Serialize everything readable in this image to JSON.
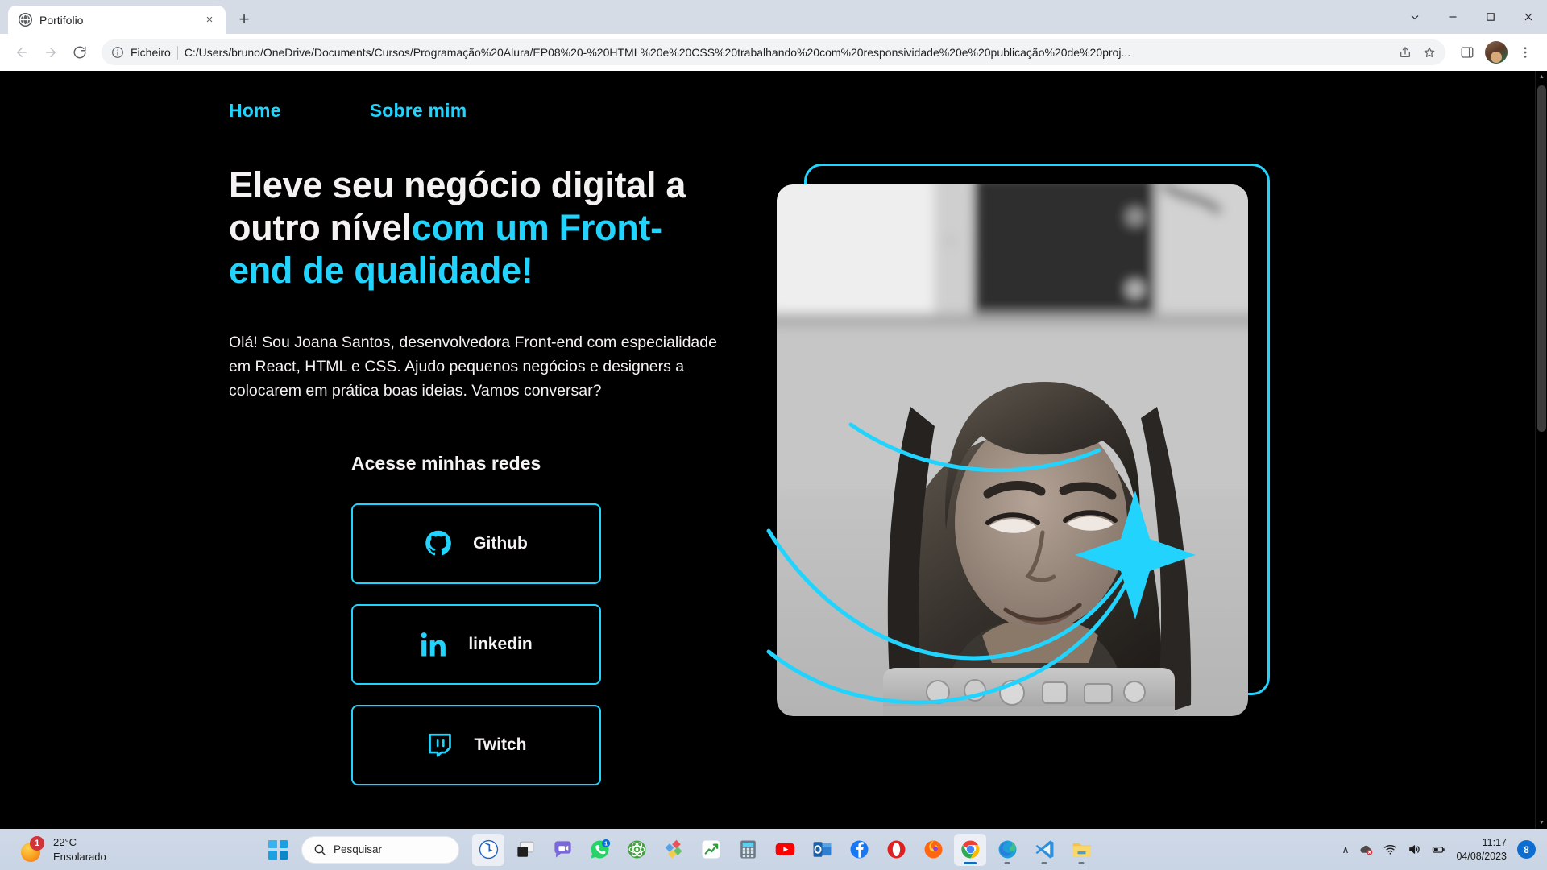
{
  "browser": {
    "tab": {
      "title": "Portifolio",
      "favicon": "globe-icon",
      "close_label": "×"
    },
    "new_tab_label": "+",
    "window_controls": {
      "minimize": "─",
      "maximize": "□",
      "close": "✕",
      "more": "⌄"
    },
    "toolbar": {
      "back": "back-arrow",
      "forward": "forward-arrow",
      "reload": "reload-icon",
      "scheme_label": "Ficheiro",
      "url": "C:/Users/bruno/OneDrive/Documents/Cursos/Programação%20Alura/EP08%20-%20HTML%20e%20CSS%20trabalhando%20com%20responsividade%20e%20publicação%20de%20proj...",
      "share": "share-icon",
      "bookmark": "star-icon",
      "sidepanel": "side-panel-icon",
      "menu": "kebab-menu-icon"
    }
  },
  "page": {
    "nav": [
      {
        "label": "Home"
      },
      {
        "label": "Sobre mim"
      }
    ],
    "headline": {
      "line_white": "Eleve seu negócio digital a outro nível",
      "line_accent": "com um Front-end de qualidade!"
    },
    "paragraph": "Olá! Sou Joana Santos, desenvolvedora Front-end com especialidade em React, HTML e CSS. Ajudo pequenos negócios e designers a colocarem em prática boas ideias. Vamos conversar?",
    "links_title": "Acesse minhas redes",
    "links": [
      {
        "label": "Github",
        "icon": "github-icon"
      },
      {
        "label": "linkedin",
        "icon": "linkedin-icon"
      },
      {
        "label": "Twitch",
        "icon": "twitch-icon"
      }
    ],
    "colors": {
      "accent": "#22d4fd",
      "background": "#000000",
      "text": "#f5f2f2"
    },
    "photo_alt": "portrait-photo-grayscale"
  },
  "taskbar": {
    "weather": {
      "temperature": "22°C",
      "condition": "Ensolarado",
      "badge": "1"
    },
    "start_label": "start-button",
    "search": {
      "placeholder": "Pesquisar",
      "icon": "search-icon"
    },
    "apps": [
      {
        "name": "bing-chat",
        "badge": null,
        "active": true,
        "running": false
      },
      {
        "name": "task-view",
        "badge": null,
        "active": false,
        "running": false
      },
      {
        "name": "teams-chat",
        "badge": null,
        "active": false,
        "running": false
      },
      {
        "name": "whatsapp",
        "badge": "1",
        "active": false,
        "running": false
      },
      {
        "name": "atom",
        "badge": null,
        "active": false,
        "running": false
      },
      {
        "name": "office",
        "badge": null,
        "active": false,
        "running": false
      },
      {
        "name": "stocks",
        "badge": null,
        "active": false,
        "running": false
      },
      {
        "name": "calculator",
        "badge": null,
        "active": false,
        "running": false
      },
      {
        "name": "youtube",
        "badge": null,
        "active": false,
        "running": false
      },
      {
        "name": "outlook",
        "badge": null,
        "active": false,
        "running": false
      },
      {
        "name": "facebook",
        "badge": null,
        "active": false,
        "running": false
      },
      {
        "name": "opera",
        "badge": null,
        "active": false,
        "running": false
      },
      {
        "name": "firefox",
        "badge": null,
        "active": false,
        "running": false
      },
      {
        "name": "google-chrome",
        "badge": null,
        "active": true,
        "running": true
      },
      {
        "name": "microsoft-edge",
        "badge": null,
        "active": false,
        "running": true
      },
      {
        "name": "vs-code",
        "badge": null,
        "active": false,
        "running": true
      },
      {
        "name": "file-explorer",
        "badge": null,
        "active": false,
        "running": true
      }
    ],
    "tray": {
      "overflow": "∧",
      "icons": [
        "onedrive-error-icon",
        "wifi-icon",
        "volume-icon",
        "battery-icon"
      ],
      "time": "11:17",
      "date": "04/08/2023",
      "notifications": "8"
    }
  }
}
